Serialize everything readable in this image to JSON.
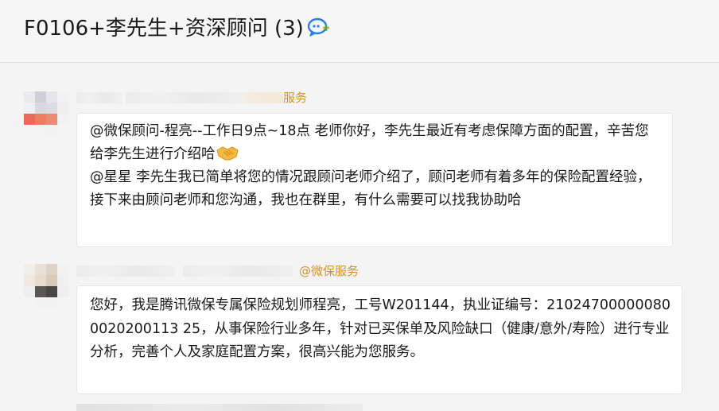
{
  "chat": {
    "title": "F0106+李先生+资深顾问 (3)",
    "title_icon": "group-chat-icon"
  },
  "messages": [
    {
      "sender_tag": "服务",
      "paragraphs": [
        "@微保顾问-程亮--工作日9点~18点 老师你好，李先生最近有考虑保障方面的配置，辛苦您给李先生进行介绍哈",
        "@星星 李先生我已简单将您的情况跟顾问老师介绍了，顾问老师有着多年的保险配置经验，接下来由顾问老师和您沟通，我也在群里，有什么需要可以找我协助哈"
      ],
      "emoji": "handshake-emoji"
    },
    {
      "sender_tag": "@微保服务",
      "paragraphs": [
        "您好，我是腾讯微保专属保险规划师程亮，工号W201144，执业证编号：210247000000800020200113 25，从事保险行业多年，针对已买保单及风险缺口（健康/意外/寿险）进行专业分析，完善个人及家庭配置方案，很高兴能为您服务。"
      ]
    }
  ],
  "colors": {
    "tag": "#d8922a",
    "bubble_bg": "#ffffff",
    "page_bg": "#f4f4f4"
  }
}
